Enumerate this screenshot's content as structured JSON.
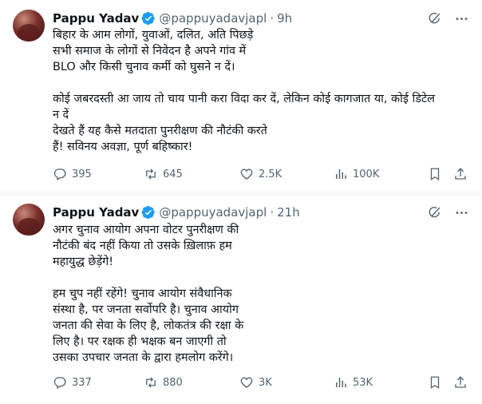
{
  "tweets": [
    {
      "author_name": "Pappu Yadav",
      "handle": "@pappuyadavjapl",
      "dot": "·",
      "time": "9h",
      "text": "बिहार के आम लोगों, युवाओं, दलित, अति पिछड़े\nसभी समाज के लोगों से निवेदन है अपने गांव में\nBLO और किसी चुनाव कर्मी को घुसने न दें।\n\nकोई जबरदस्ती आ जाय तो चाय पानी करा विदा कर दें, लेकिन कोई कागजात या, कोई डिटेल\nन दें\nदेखते हैं यह कैसे मतदाता पुनरीक्षण की नौटंकी करते\nहैं! सविनय अवज्ञा, पूर्ण बहिष्कार!",
      "replies": "395",
      "reposts": "645",
      "likes": "2.5K",
      "views": "100K"
    },
    {
      "author_name": "Pappu Yadav",
      "handle": "@pappuyadavjapl",
      "dot": "·",
      "time": "21h",
      "text": "अगर चुनाव आयोग अपना वोटर पुनरीक्षण की\nनौटंकी बंद नहीं किया तो उसके ख़िलाफ़ हम\nमहायुद्ध छेड़ेंगे!\n\nहम चुप नहीं रहेंगे! चुनाव आयोग संवैधानिक\nसंस्था है, पर जनता सर्वोपरि है। चुनाव आयोग\nजनता की सेवा के लिए है, लोकतंत्र की रक्षा के\nलिए है। पर रक्षक ही भक्षक बन जाएगी तो\nउसका उपचार जनता के द्वारा हमलोग करेंगे।",
      "replies": "337",
      "reposts": "880",
      "likes": "3K",
      "views": "53K"
    }
  ],
  "icons": {
    "verified": "verified-badge-icon",
    "grok": "grok-icon",
    "more": "more-icon",
    "reply": "reply-icon",
    "repost": "repost-icon",
    "like": "heart-icon",
    "views": "views-icon",
    "bookmark": "bookmark-icon",
    "share": "share-icon"
  },
  "colors": {
    "verified": "#1d9bf0",
    "secondary_text": "#536471",
    "primary_text": "#0f1419",
    "divider": "#eff3f4"
  }
}
